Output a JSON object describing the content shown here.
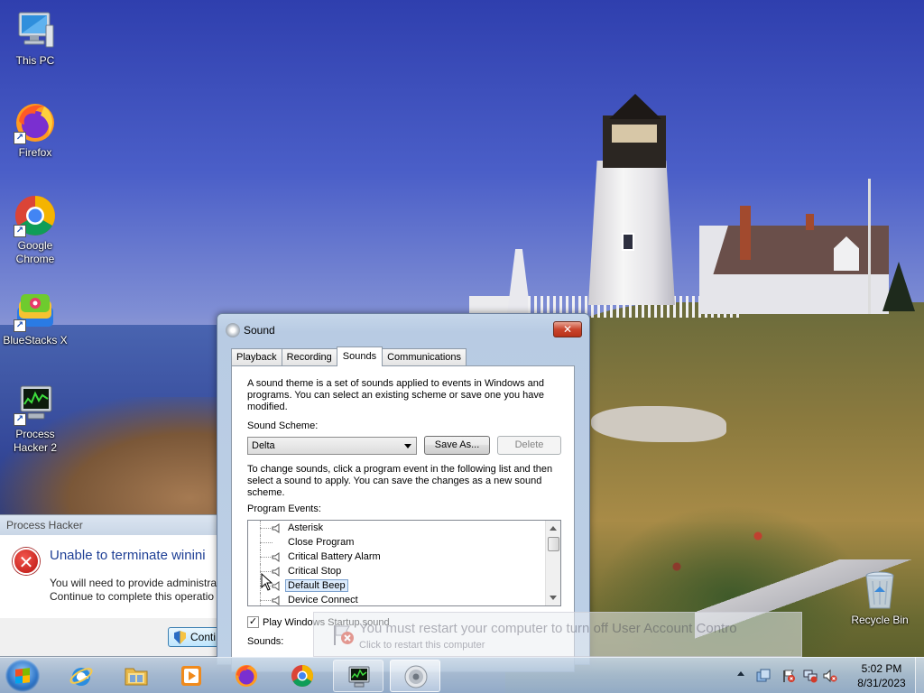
{
  "desktop": {
    "icons": [
      {
        "label": "This PC",
        "icon": "computer-icon"
      },
      {
        "label": "Firefox",
        "icon": "firefox-icon"
      },
      {
        "label": "Google Chrome",
        "icon": "chrome-icon"
      },
      {
        "label": "BlueStacks X",
        "icon": "bluestacks-icon"
      },
      {
        "label": "Process Hacker 2",
        "icon": "process-hacker-icon"
      },
      {
        "label": "Recycle Bin",
        "icon": "recycle-bin-icon"
      }
    ]
  },
  "process_hacker": {
    "title": "Process Hacker",
    "heading": "Unable to terminate winini",
    "message_line1": "You will need to provide administra",
    "message_line2": "Continue to complete this operatio",
    "continue_label": "Conti"
  },
  "sound_dialog": {
    "title": "Sound",
    "close_label": "✕",
    "tabs": [
      {
        "label": "Playback",
        "active": false
      },
      {
        "label": "Recording",
        "active": false
      },
      {
        "label": "Sounds",
        "active": true
      },
      {
        "label": "Communications",
        "active": false
      }
    ],
    "description": "A sound theme is a set of sounds applied to events in Windows and programs.  You can select an existing scheme or save one you have modified.",
    "scheme_label": "Sound Scheme:",
    "scheme_value": "Delta",
    "save_as_label": "Save As...",
    "delete_label": "Delete",
    "change_text": "To change sounds, click a program event in the following list and then select a sound to apply.  You can save the changes as a new sound scheme.",
    "events_label": "Program Events:",
    "events": [
      {
        "label": "Asterisk",
        "has_sound": true,
        "selected": false
      },
      {
        "label": "Close Program",
        "has_sound": false,
        "selected": false
      },
      {
        "label": "Critical Battery Alarm",
        "has_sound": true,
        "selected": false
      },
      {
        "label": "Critical Stop",
        "has_sound": true,
        "selected": false
      },
      {
        "label": "Default Beep",
        "has_sound": true,
        "selected": true
      },
      {
        "label": "Device Connect",
        "has_sound": true,
        "selected": false
      }
    ],
    "startup_checked": "✓",
    "startup_label": "Play Windows Startup sound",
    "sounds_label": "Sounds:"
  },
  "toast": {
    "title": "You must restart your computer to turn off User Account Contro",
    "subtitle": "Click to restart this computer"
  },
  "taskbar": {
    "pinned": [
      {
        "name": "internet-explorer",
        "icon": "ie-icon"
      },
      {
        "name": "file-explorer",
        "icon": "folder-icon"
      },
      {
        "name": "media-player",
        "icon": "media-player-icon"
      },
      {
        "name": "firefox",
        "icon": "firefox-icon"
      },
      {
        "name": "chrome",
        "icon": "chrome-icon"
      },
      {
        "name": "process-hacker",
        "icon": "process-hacker-icon"
      },
      {
        "name": "sound",
        "icon": "speaker-icon"
      }
    ],
    "time": "5:02 PM",
    "date": "8/31/2023"
  }
}
